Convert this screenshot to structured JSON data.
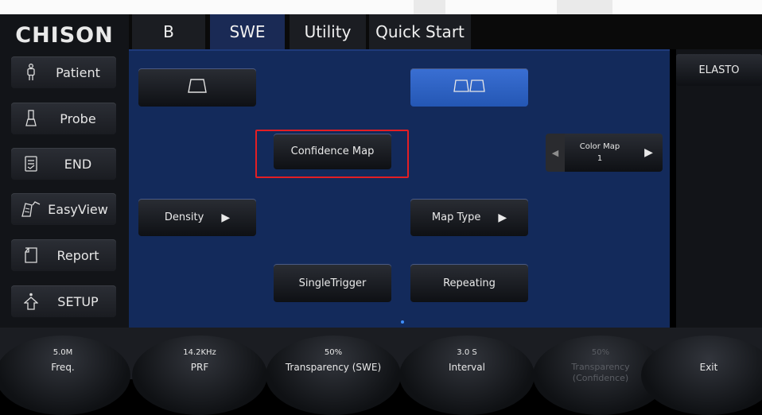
{
  "brand": "CHISON",
  "tabs": [
    "B",
    "SWE",
    "Utility",
    "Quick Start"
  ],
  "active_tab": "SWE",
  "sidebar": [
    {
      "label": "Patient",
      "icon": "patient-icon"
    },
    {
      "label": "Probe",
      "icon": "probe-icon"
    },
    {
      "label": "END",
      "icon": "end-icon"
    },
    {
      "label": "EasyView",
      "icon": "easyview-icon"
    },
    {
      "label": "Report",
      "icon": "report-icon"
    },
    {
      "label": "SETUP",
      "icon": "setup-icon"
    }
  ],
  "main": {
    "confidence_map": "Confidence Map",
    "density": "Density",
    "map_type": "Map Type",
    "single_trigger": "SingleTrigger",
    "repeating": "Repeating",
    "color_map": {
      "label": "Color Map",
      "value": "1"
    }
  },
  "right_panel": {
    "elasto": "ELASTO"
  },
  "knobs": [
    {
      "value": "5.0M",
      "name": "Freq."
    },
    {
      "value": "14.2KHz",
      "name": "PRF"
    },
    {
      "value": "50%",
      "name": "Transparency (SWE)"
    },
    {
      "value": "3.0 S",
      "name": "Interval"
    },
    {
      "value": "50%",
      "name": "Transparency",
      "name2": "(Confidence)",
      "disabled": true
    },
    {
      "value": "",
      "name": "Exit"
    }
  ],
  "colors": {
    "main_bg": "#132a5b",
    "active_tab": "#1a2a55",
    "selected_button": "#2f63c4",
    "highlight": "#e31e24"
  }
}
